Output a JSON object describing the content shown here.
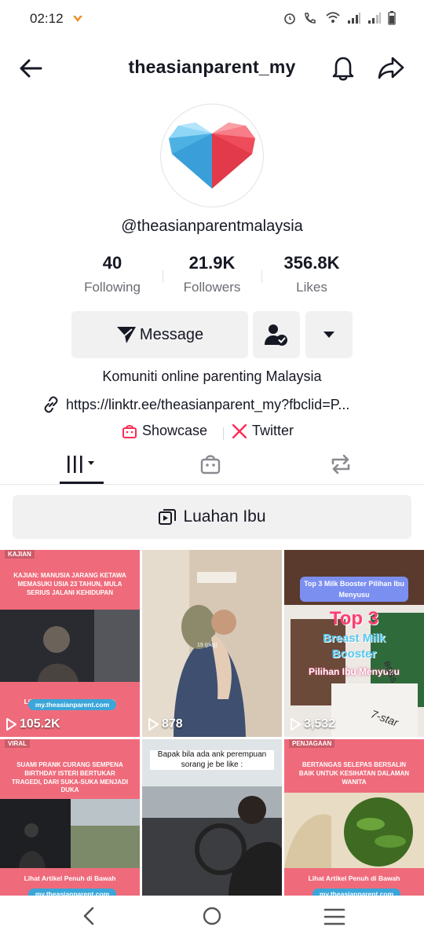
{
  "status_bar": {
    "time": "02:12"
  },
  "header": {
    "title": "theasianparent_my"
  },
  "profile": {
    "username": "@theasianparentmalaysia",
    "stats": [
      {
        "value": "40",
        "label": "Following"
      },
      {
        "value": "21.9K",
        "label": "Followers"
      },
      {
        "value": "356.8K",
        "label": "Likes"
      }
    ],
    "message_label": "Message",
    "bio": "Komuniti online parenting Malaysia",
    "link": "https://linktr.ee/theasianparent_my?fbclid=P...",
    "showcase_label": "Showcase",
    "twitter_label": "Twitter"
  },
  "playlist": {
    "label": "Luahan Ibu"
  },
  "videos": [
    {
      "views": "105.2K",
      "tag": "KAJIAN",
      "headline": "KAJIAN: MANUSIA JARANG KETAWA MEMASUKI USIA 23 TAHUN, MULA SERIUS JALANI KEHIDUPAN",
      "cta": "Lihat Artikel Penuh di Bawah",
      "url": "my.theasianparent.com"
    },
    {
      "views": "878",
      "overlay": "19 (pkg)"
    },
    {
      "views": "3,532",
      "badge": "Top 3 Milk Booster Pilihan Ibu Menyusu",
      "big1": "Top 3",
      "big2": "Breast Milk",
      "big3": "Booster",
      "big4": "Pilihan Ibu Menyusu",
      "stamp": "7-star",
      "brand": "BOSS"
    },
    {
      "tag": "VIRAL",
      "headline": "SUAMI PRANK CURANG SEMPENA BIRTHDAY ISTERI BERTUKAR TRAGEDI, DARI SUKA-SUKA MENJADI DUKA",
      "cta": "Lihat Artikel Penuh di Bawah",
      "url": "my.theasianparent.com"
    },
    {
      "caption": "Bapak bila ada ank perempuan sorang je be like :"
    },
    {
      "tag": "PENJAGAAN",
      "headline": "BERTANGAS SELEPAS BERSALIN BAIK UNTUK KESIHATAN DALAMAN WANITA",
      "cta": "Lihat Artikel Penuh di Bawah",
      "url": "my.theasianparent.com"
    }
  ],
  "colors": {
    "text_primary": "#161823",
    "text_secondary": "#6b6c72",
    "button_bg": "#f1f1f2",
    "accent_red": "#fe2c55",
    "card_pink": "#ef6b7b"
  }
}
